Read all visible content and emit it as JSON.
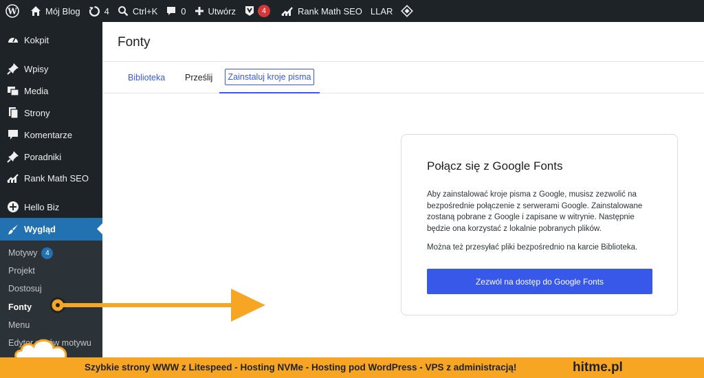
{
  "admin_bar": {
    "site_name": "Mój Blog",
    "updates_count": "4",
    "search_shortcut": "Ctrl+K",
    "comments_count": "0",
    "create_label": "Utwórz",
    "yoast_badge": "4",
    "rank_math_label": "Rank Math SEO",
    "llar_label": "LLAR"
  },
  "sidebar": {
    "items": [
      {
        "label": "Kokpit",
        "icon": "dashboard-icon"
      },
      {
        "label": "Wpisy",
        "icon": "pin-icon"
      },
      {
        "label": "Media",
        "icon": "media-icon"
      },
      {
        "label": "Strony",
        "icon": "pages-icon"
      },
      {
        "label": "Komentarze",
        "icon": "comment-icon"
      },
      {
        "label": "Poradniki",
        "icon": "pin-icon"
      },
      {
        "label": "Rank Math SEO",
        "icon": "rank-math-icon"
      },
      {
        "label": "Hello Biz",
        "icon": "plus-circle-icon"
      },
      {
        "label": "Wygląd",
        "icon": "brush-icon"
      }
    ],
    "submenu": {
      "motywy": "Motywy",
      "motywy_badge": "4",
      "projekt": "Projekt",
      "dostosuj": "Dostosuj",
      "fonty": "Fonty",
      "menu": "Menu",
      "edytor": "Edytor plików motywu"
    }
  },
  "page": {
    "title": "Fonty",
    "tabs": [
      {
        "label": "Biblioteka"
      },
      {
        "label": "Prześlij"
      },
      {
        "label": "Zainstaluj kroje pisma"
      }
    ],
    "card": {
      "title": "Połącz się z Google Fonts",
      "paragraph1": "Aby zainstalować kroje pisma z Google, musisz zezwolić na bezpośrednie połączenie z serwerami Google. Zainstalowane zostaną pobrane z Google i zapisane w witrynie. Następnie będzie ona korzystać z lokalnie pobranych plików.",
      "paragraph2": "Można też przesyłać pliki bezpośrednio na karcie Biblioteka.",
      "button_label": "Zezwól na dostęp do Google Fonts"
    }
  },
  "banner": {
    "text": "Szybkie strony WWW z Litespeed - Hosting  NVMe - Hosting pod WordPress - VPS z administracją!",
    "brand": "hitme.pl"
  },
  "colors": {
    "admin_dark": "#1d2327",
    "submenu_bg": "#2c3338",
    "wp_blue": "#2271b1",
    "accent_blue": "#3858e9",
    "badge_red": "#d63638",
    "overlay_orange": "#f6a623"
  }
}
